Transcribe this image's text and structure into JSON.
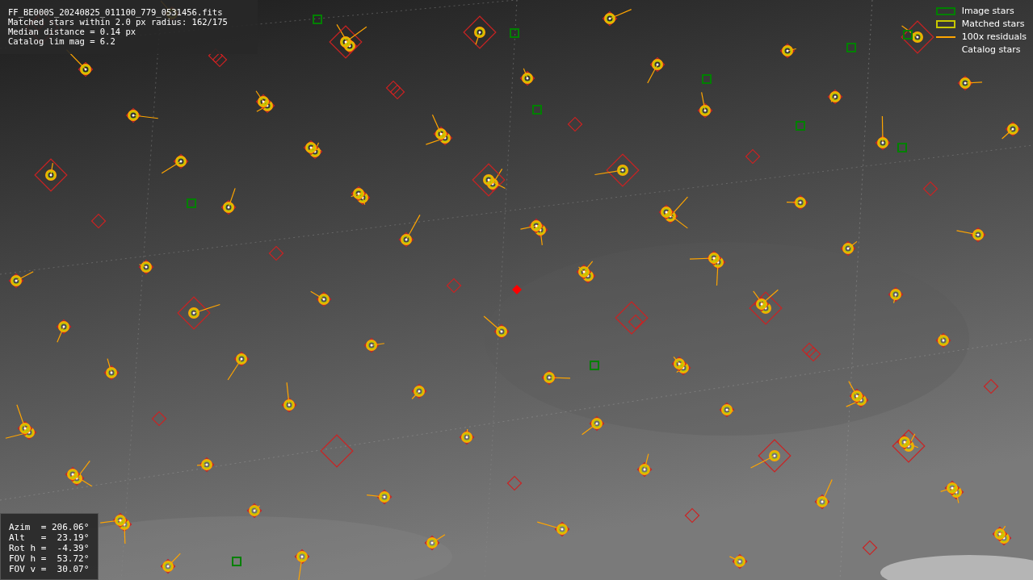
{
  "info": {
    "lines": [
      "FF_BE000S_20240825_011100_779_0531456.fits",
      "Matched stars within 2.0 px radius: 162/175",
      "Median distance = 0.14 px",
      "Catalog lim mag = 6.2"
    ]
  },
  "legend": [
    {
      "label": "Image stars",
      "color": "#008000"
    },
    {
      "kind": "matched",
      "label": "Matched stars",
      "color": "#c8c800"
    },
    {
      "kind": "residual",
      "label": "100x residuals",
      "color": "#ffa500"
    },
    {
      "kind": "catalog",
      "label": "Catalog stars"
    }
  ],
  "pointing": {
    "lines": [
      "Azim  = 206.06°",
      "Alt   =  23.19°",
      "Rot h =  -4.39°",
      "FOV h =  53.72°",
      "FOV v =  30.07°"
    ]
  }
}
